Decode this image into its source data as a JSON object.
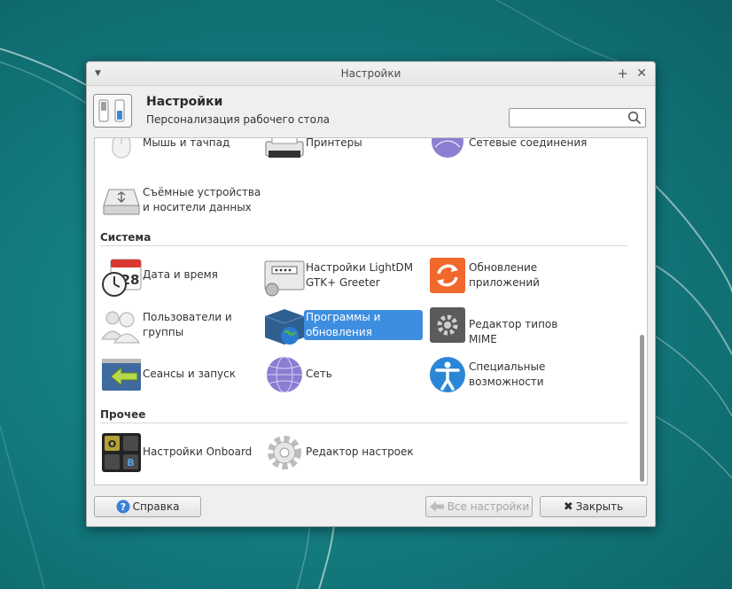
{
  "window": {
    "title": "Настройки",
    "header_title": "Настройки",
    "header_subtitle": "Персонализация рабочего стола",
    "search_value": ""
  },
  "sections": [
    {
      "title": "",
      "items": [
        {
          "label": "Мышь и тачпад",
          "icon": "mouse-icon"
        },
        {
          "label": "Принтеры",
          "icon": "printer-icon"
        },
        {
          "label": "Сетевые соединения",
          "icon": "network-connections-icon"
        },
        {
          "label": "Съёмные устройства и носители данных",
          "icon": "removable-drive-icon"
        }
      ]
    },
    {
      "title": "Система",
      "items": [
        {
          "label": "Дата и время",
          "icon": "calendar-clock-icon"
        },
        {
          "label": "Настройки LightDM GTK+ Greeter",
          "icon": "login-screen-icon"
        },
        {
          "label": "Обновление приложений",
          "icon": "update-icon"
        },
        {
          "label": "Пользователи и группы",
          "icon": "users-icon"
        },
        {
          "label": "Программы и обновления",
          "icon": "software-sources-icon",
          "selected": true
        },
        {
          "label": "Редактор типов MIME",
          "icon": "mime-editor-icon"
        },
        {
          "label": "Сеансы и запуск",
          "icon": "session-icon"
        },
        {
          "label": "Сеть",
          "icon": "network-icon"
        },
        {
          "label": "Специальные возможности",
          "icon": "accessibility-icon"
        }
      ]
    },
    {
      "title": "Прочее",
      "items": [
        {
          "label": "Настройки Onboard",
          "icon": "onboard-keyboard-icon"
        },
        {
          "label": "Редактор настроек",
          "icon": "settings-editor-icon"
        }
      ]
    }
  ],
  "buttons": {
    "help": "Справка",
    "all_settings": "Все настройки",
    "close": "Закрыть"
  },
  "colors": {
    "selection": "#3d8ee0",
    "desktop": "#137b7f"
  }
}
